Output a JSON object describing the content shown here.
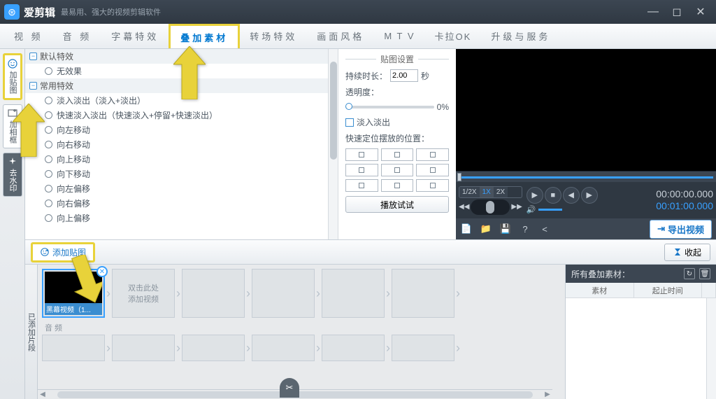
{
  "app": {
    "title": "爱剪辑",
    "subtitle": "最易用、强大的视频剪辑软件"
  },
  "tabs": {
    "video": "视  频",
    "audio": "音  频",
    "subtitle": "字幕特效",
    "overlay": "叠加素材",
    "transition": "转场特效",
    "style": "画面风格",
    "mtv": "M T V",
    "karaoke": "卡拉OK",
    "upgrade": "升级与服务"
  },
  "leftbar": {
    "sticker": "加贴图",
    "frame": "加相框",
    "watermark": "去水印"
  },
  "effects": {
    "group1": "默认特效",
    "g1_items": [
      "无效果"
    ],
    "group2": "常用特效",
    "g2_items": [
      "淡入淡出（淡入+淡出）",
      "快速淡入淡出（快速淡入+停留+快速淡出）",
      "向左移动",
      "向右移动",
      "向上移动",
      "向下移动",
      "向左偏移",
      "向右偏移",
      "向上偏移"
    ]
  },
  "settings": {
    "title": "贴图设置",
    "duration_label": "持续时长：",
    "duration_value": "2.00",
    "duration_unit": "秒",
    "opacity_label": "透明度：",
    "opacity_value": "0%",
    "fade_label": "淡入淡出",
    "position_label": "快速定位摆放的位置：",
    "play_test": "播放试试"
  },
  "addrow": {
    "add_sticker": "添加贴图",
    "collapse": "收起"
  },
  "timeline": {
    "label": "已添加片段",
    "clip1": "黑幕视频（1...",
    "placeholder": "双击此处\n添加视频",
    "audio": "音 频"
  },
  "preview": {
    "speed_half": "1/2X",
    "speed_1": "1X",
    "speed_2": "2X",
    "tc_cur": "00:00:00.000",
    "tc_dur": "00:01:00.000",
    "export": "导出视频"
  },
  "materials": {
    "title": "所有叠加素材：",
    "col1": "素材",
    "col2": "起止时间"
  }
}
